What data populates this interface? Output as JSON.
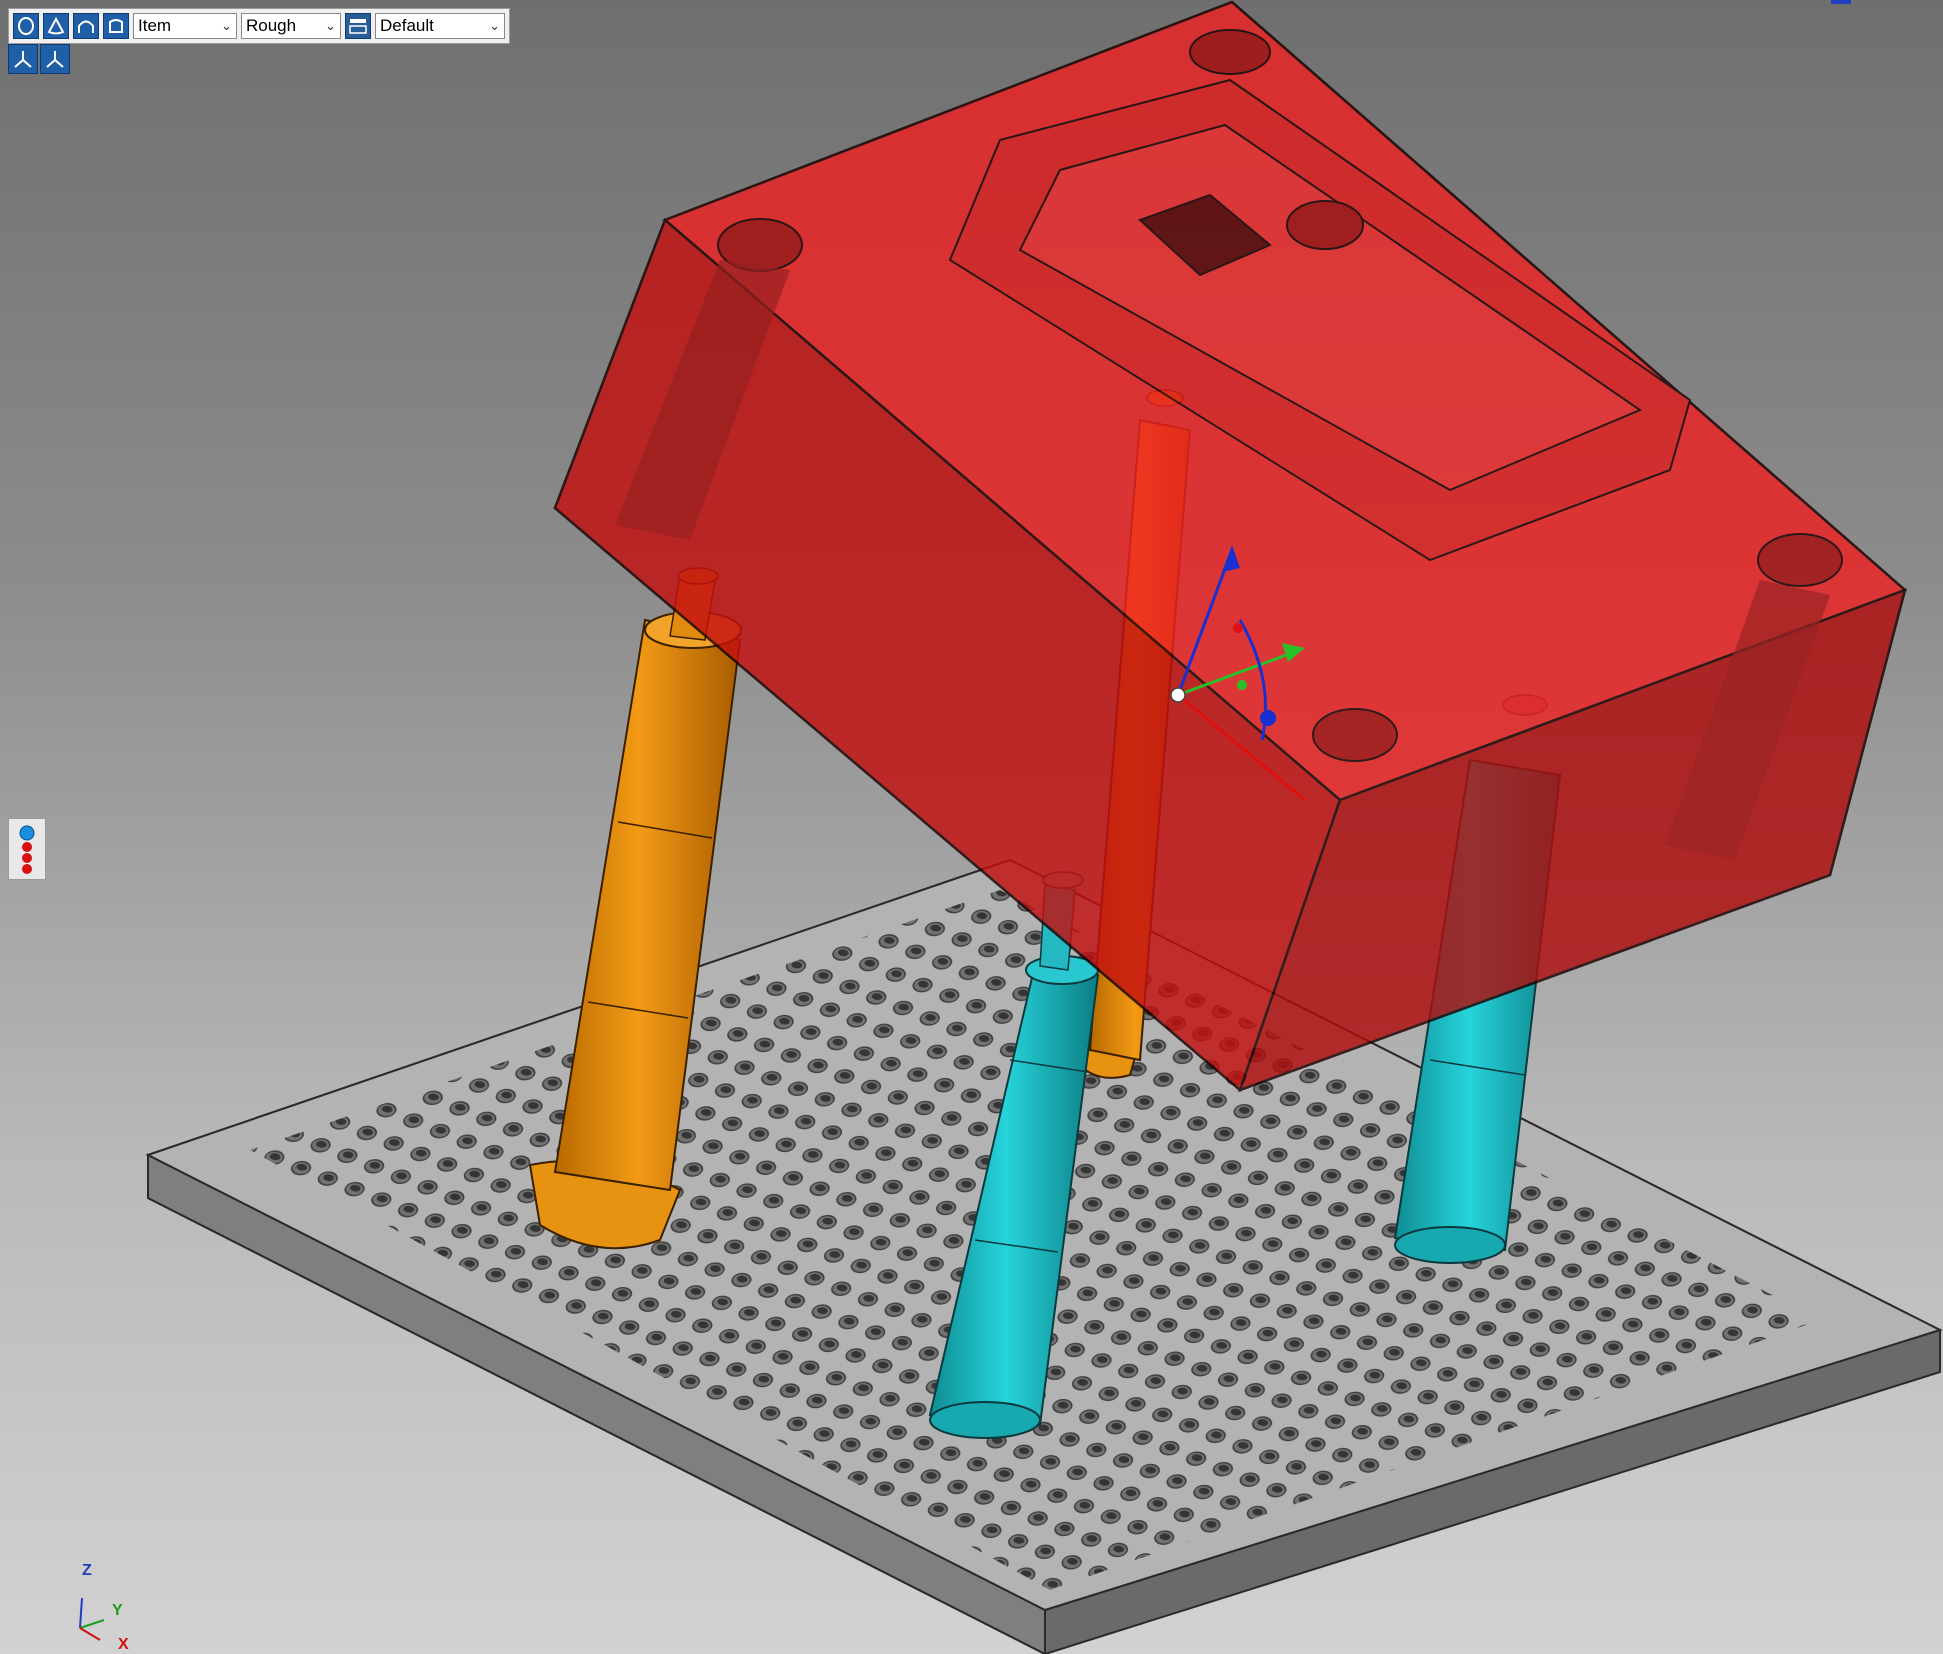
{
  "toolbar": {
    "view_buttons": [
      {
        "icon": "shaded-circle-icon"
      },
      {
        "icon": "cone-icon"
      },
      {
        "icon": "arch-icon"
      },
      {
        "icon": "box-face-icon"
      }
    ],
    "selection_mode": "Item",
    "quality": "Rough",
    "display_icon": "display-layout-icon",
    "display_style": "Default",
    "secondary_buttons": [
      {
        "icon": "axis-triad-icon"
      },
      {
        "icon": "axis-triad-alt-icon"
      }
    ]
  },
  "side_widget": {
    "icon": "color-markers-icon"
  },
  "triad": {
    "z": "Z",
    "y": "Y",
    "x": "X"
  },
  "colors": {
    "mold_block": "#e01818",
    "orange_support": "#e89212",
    "cyan_support": "#1fbcc4",
    "fixture_plate": "#9a9a9a",
    "toolbar_button": "#1f5fa8"
  }
}
